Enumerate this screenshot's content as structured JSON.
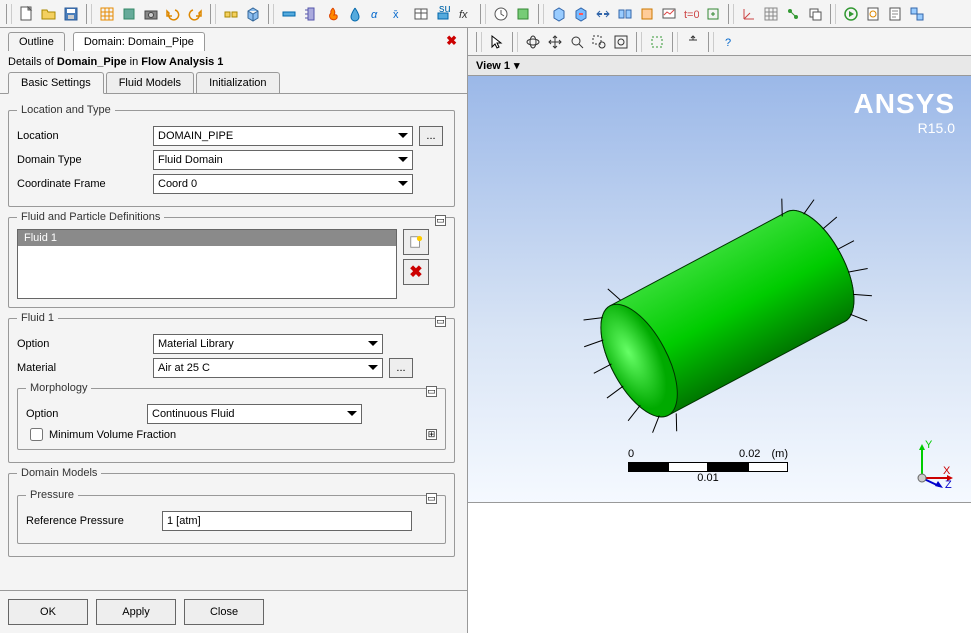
{
  "tabs": {
    "outline": "Outline",
    "domain": "Domain: Domain_Pipe"
  },
  "details_prefix": "Details of ",
  "details_domain": "Domain_Pipe",
  "details_mid": " in ",
  "details_analysis": "Flow Analysis 1",
  "subtabs": {
    "basic": "Basic Settings",
    "fluid": "Fluid Models",
    "init": "Initialization"
  },
  "groups": {
    "loc_type": "Location and Type",
    "fluid_defs": "Fluid and Particle Definitions",
    "fluid1": "Fluid 1",
    "morphology": "Morphology",
    "domain_models": "Domain Models",
    "pressure": "Pressure"
  },
  "labels": {
    "location": "Location",
    "domain_type": "Domain Type",
    "coord_frame": "Coordinate Frame",
    "option": "Option",
    "material": "Material",
    "morph_option": "Option",
    "min_vol": "Minimum Volume Fraction",
    "ref_pressure": "Reference Pressure"
  },
  "values": {
    "location": "DOMAIN_PIPE",
    "domain_type": "Fluid Domain",
    "coord_frame": "Coord 0",
    "fluid_list_item": "Fluid 1",
    "option": "Material Library",
    "material": "Air at 25 C",
    "morph_option": "Continuous Fluid",
    "ref_pressure": "1 [atm]"
  },
  "buttons": {
    "ok": "OK",
    "apply": "Apply",
    "close": "Close",
    "dots": "..."
  },
  "view": {
    "title": "View 1",
    "brand": "ANSYS",
    "version": "R15.0"
  },
  "scale": {
    "start": "0",
    "end": "0.02",
    "unit": "(m)",
    "mid": "0.01"
  },
  "triad": {
    "x": "X",
    "y": "Y",
    "z": "Z"
  }
}
